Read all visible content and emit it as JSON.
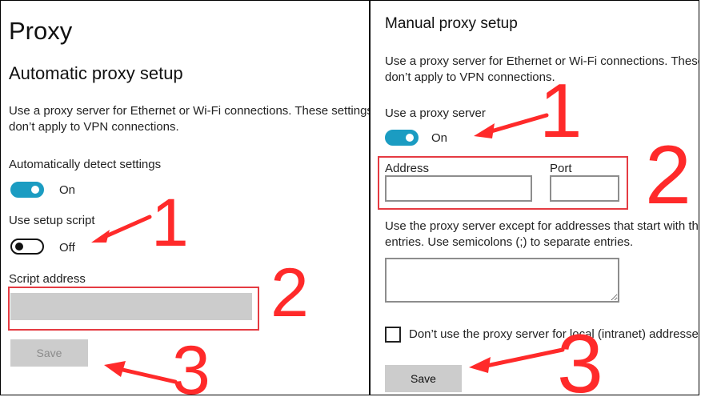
{
  "left_panel": {
    "title": "Proxy",
    "section_title": "Automatic proxy setup",
    "description": "Use a proxy server for Ethernet or Wi-Fi connections. These settings don’t apply to VPN connections.",
    "auto_detect": {
      "label": "Automatically detect settings",
      "state": "On"
    },
    "setup_script": {
      "label": "Use setup script",
      "state": "Off"
    },
    "script_address": {
      "label": "Script address",
      "value": ""
    },
    "save_label": "Save"
  },
  "right_panel": {
    "title": "Manual proxy setup",
    "description": "Use a proxy server for Ethernet or Wi-Fi connections. These se don’t apply to VPN connections.",
    "use_proxy": {
      "label": "Use a proxy server",
      "state": "On"
    },
    "address": {
      "label": "Address",
      "value": ""
    },
    "port": {
      "label": "Port",
      "value": ""
    },
    "exceptions": {
      "description": "Use the proxy server except for addresses that start with the f entries. Use semicolons (;) to separate entries.",
      "value": ""
    },
    "local_bypass": {
      "label": "Don’t use the proxy server for local (intranet) addresses"
    },
    "save_label": "Save"
  },
  "annotations": {
    "left": [
      "1",
      "2",
      "3"
    ],
    "right": [
      "1",
      "2",
      "3"
    ]
  },
  "colors": {
    "toggle_on": "#1b9cc2",
    "annotation_red": "#ff2a2a",
    "highlight_red": "#e53b42",
    "button_gray": "#cccccc"
  },
  "icons": {
    "toggle_on": "toggle-on-icon",
    "toggle_off": "toggle-off-icon",
    "checkbox": "checkbox-icon",
    "arrow": "annotation-arrow-icon"
  }
}
